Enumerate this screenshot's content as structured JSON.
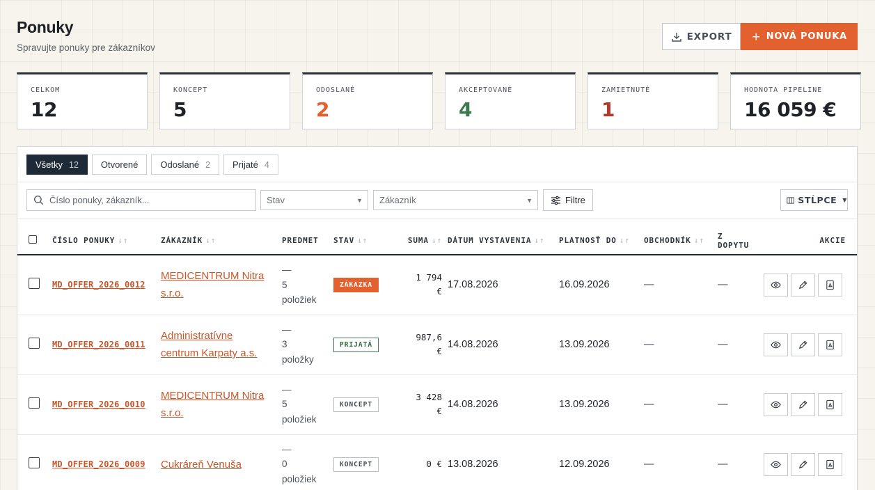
{
  "header": {
    "title": "Ponuky",
    "subtitle": "Spravujte ponuky pre zákazníkov"
  },
  "actions": {
    "export_label": "EXPORT",
    "new_label": "NOVÁ PONUKA",
    "new_plus": "+"
  },
  "stats": [
    {
      "label": "CELKOM",
      "value": "12",
      "color": "#1f2329"
    },
    {
      "label": "KONCEPT",
      "value": "5",
      "color": "#1f2329"
    },
    {
      "label": "ODOSLANÉ",
      "value": "2",
      "color": "#e2612f"
    },
    {
      "label": "AKCEPTOVANÉ",
      "value": "4",
      "color": "#3d7a4f"
    },
    {
      "label": "ZAMIETNUTÉ",
      "value": "1",
      "color": "#b23a2a"
    },
    {
      "label": "HODNOTA PIPELINE",
      "value": "16 059 €",
      "color": "#1f2329"
    }
  ],
  "tabs": [
    {
      "label": "Všetky",
      "count": "12"
    },
    {
      "label": "Otvorené",
      "count": ""
    },
    {
      "label": "Odoslané",
      "count": "2"
    },
    {
      "label": "Prijaté",
      "count": "4"
    }
  ],
  "filters": {
    "search_placeholder": "Číslo ponuky, zákazník...",
    "status_placeholder": "Stav",
    "customer_placeholder": "Zákazník",
    "filter_label": "Filtre",
    "columns_label": "STĹPCE"
  },
  "columns": {
    "number": "ČÍSLO PONUKY",
    "customer": "ZÁKAZNÍK",
    "subject": "PREDMET",
    "status": "STAV",
    "sum": "SUMA",
    "issued": "DÁTUM VYSTAVENIA",
    "valid": "PLATNOSŤ DO",
    "salesperson": "OBCHODNÍK",
    "from_inquiry_1": "Z",
    "from_inquiry_2": "DOPYTU",
    "actions": "AKCIE"
  },
  "rows": [
    {
      "number": "MD_OFFER_2026_0012",
      "customer_1": "MEDICENTRUM Nitra",
      "customer_2": "s.r.o.",
      "subj_dash": "—",
      "subj_count": "5",
      "subj_unit": "položiek",
      "status": "ZÁKAZKA",
      "status_kind": "zakazka",
      "sum_1": "1 794",
      "sum_2": "€",
      "issued": "17.08.2026",
      "valid": "16.09.2026",
      "salesperson": "—",
      "inquiry": "—"
    },
    {
      "number": "MD_OFFER_2026_0011",
      "customer_1": "Administratívne",
      "customer_2": "centrum Karpaty a.s.",
      "subj_dash": "—",
      "subj_count": "3",
      "subj_unit": "položky",
      "status": "PRIJATÁ",
      "status_kind": "prijata",
      "sum_1": "987,6",
      "sum_2": "€",
      "issued": "14.08.2026",
      "valid": "13.09.2026",
      "salesperson": "—",
      "inquiry": "—"
    },
    {
      "number": "MD_OFFER_2026_0010",
      "customer_1": "MEDICENTRUM Nitra",
      "customer_2": "s.r.o.",
      "subj_dash": "—",
      "subj_count": "5",
      "subj_unit": "položiek",
      "status": "KONCEPT",
      "status_kind": "koncept",
      "sum_1": "3 428",
      "sum_2": "€",
      "issued": "14.08.2026",
      "valid": "13.09.2026",
      "salesperson": "—",
      "inquiry": "—"
    },
    {
      "number": "MD_OFFER_2026_0009",
      "customer_1": "Cukráreň Venuša",
      "customer_2": "",
      "subj_dash": "—",
      "subj_count": "0",
      "subj_unit": "položiek",
      "status": "KONCEPT",
      "status_kind": "koncept",
      "sum_1": "0 €",
      "sum_2": "",
      "issued": "13.08.2026",
      "valid": "12.09.2026",
      "salesperson": "—",
      "inquiry": "—"
    }
  ]
}
